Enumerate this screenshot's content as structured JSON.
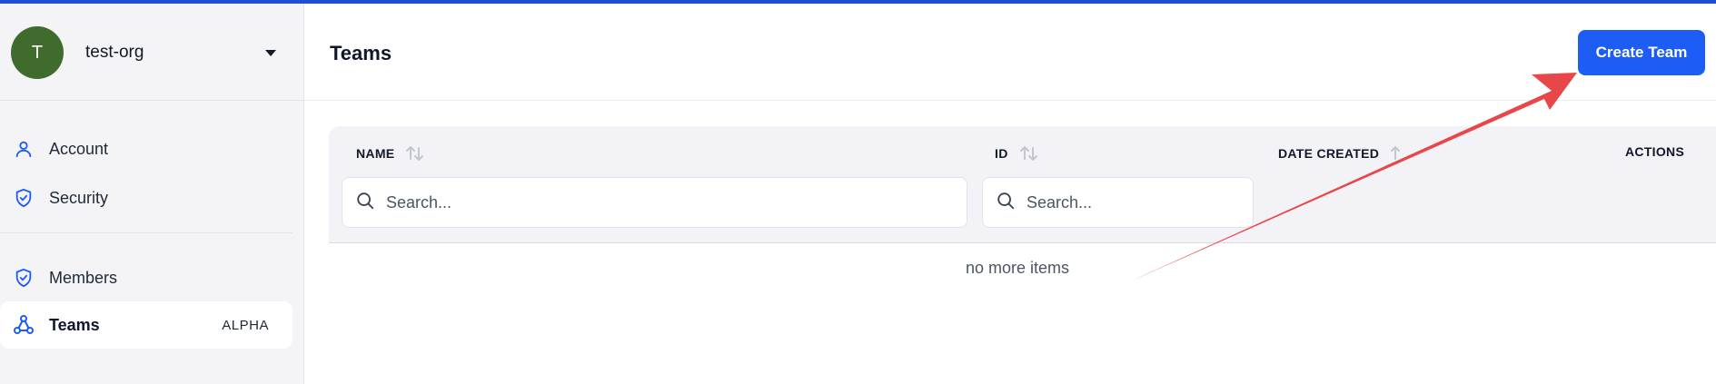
{
  "sidebar": {
    "org": {
      "initial": "T",
      "name": "test-org"
    },
    "items": [
      {
        "label": "Account"
      },
      {
        "label": "Security"
      },
      {
        "label": "Members"
      },
      {
        "label": "Teams",
        "badge": "ALPHA",
        "active": true
      }
    ]
  },
  "header": {
    "title": "Teams",
    "create_button": "Create Team"
  },
  "table": {
    "columns": [
      {
        "label": "NAME"
      },
      {
        "label": "ID"
      },
      {
        "label": "DATE CREATED"
      },
      {
        "label": "ACTIONS"
      }
    ],
    "name_search_placeholder": "Search...",
    "id_search_placeholder": "Search...",
    "empty_text": "no more items"
  },
  "colors": {
    "accent": "#1d5cf5",
    "annotation_arrow": "#e8474a",
    "avatar": "#3f6b2d"
  }
}
